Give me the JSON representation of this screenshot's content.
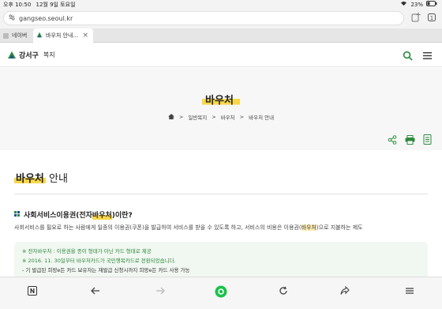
{
  "status_bar": {
    "time": "오후 10:50",
    "date": "12월 9일 토요일",
    "battery": "23%"
  },
  "browser": {
    "url": "gangseo.seoul.kr",
    "tabs": [
      {
        "label": "네이버"
      },
      {
        "label": "바우처 안내..."
      }
    ]
  },
  "site": {
    "logo_text": "강서구",
    "logo_sub": "복지"
  },
  "hero": {
    "title": "바우처",
    "breadcrumb": [
      "일반복지",
      "바우처",
      "바우처 안내"
    ]
  },
  "content": {
    "heading_highlight": "바우처",
    "heading_rest": " 안내",
    "section_title_pre": "사회서비스이용권(전자",
    "section_title_hl": "바우처",
    "section_title_post": ")이란?",
    "desc_pre": "사회서비스를 필요로 하는 사람에게 일종의 이용권(쿠폰)을 발급하여 서비스를 받을 수 있도록 하고, 서비스의 비용은 이용권(",
    "desc_hl": "바우처",
    "desc_post": ")으로 지불하는 제도",
    "notice_lines": [
      "※ 전자바우처 : 이용권을 종이 형태가 아닌 카드 형태로 제공",
      "※ 2016. 11. 30일부터 바우처카드가 국민행복카드로 전환되었습니다.",
      "- 기 발급된 희망e든 카드 보유자는 재발급 신청시까지 희망e든 카드 사용 가능"
    ]
  },
  "colors": {
    "accent_green": "#2d8a3e",
    "highlight_yellow": "#f9d74a"
  }
}
